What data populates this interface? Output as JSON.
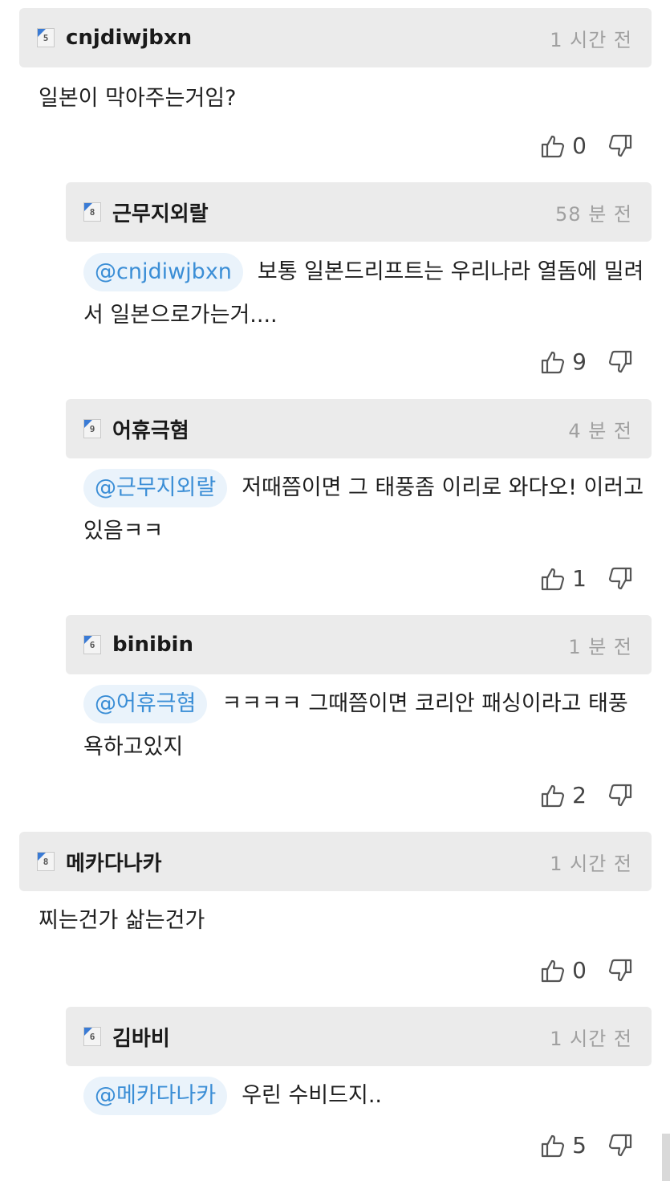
{
  "comments": [
    {
      "user": "cnjdiwjbxn",
      "level": "5",
      "time": "1 시간 전",
      "mention": "",
      "text": "일본이 막아주는거임?",
      "likes": "0"
    },
    {
      "user": "근무지외랄",
      "level": "8",
      "time": "58 분 전",
      "mention": "@cnjdiwjbxn",
      "text": "보통 일본드리프트는 우리나라 열돔에 밀려서 일본으로가는거....",
      "likes": "9"
    },
    {
      "user": "어휴극혐",
      "level": "9",
      "time": "4 분 전",
      "mention": "@근무지외랄",
      "text": "저때쯤이면 그 태풍좀 이리로 와다오! 이러고있음ㅋㅋ",
      "likes": "1"
    },
    {
      "user": "binibin",
      "level": "6",
      "time": "1 분 전",
      "mention": "@어휴극혐",
      "text": "ㅋㅋㅋㅋ 그때쯤이면 코리안 패싱이라고 태풍 욕하고있지",
      "likes": "2"
    },
    {
      "user": "메카다나카",
      "level": "8",
      "time": "1 시간 전",
      "mention": "",
      "text": "찌는건가 삶는건가",
      "likes": "0"
    },
    {
      "user": "김바비",
      "level": "6",
      "time": "1 시간 전",
      "mention": "@메카다나카",
      "text": "우린 수비드지..",
      "likes": "5"
    }
  ],
  "icons": {
    "like": "thumbs-up-icon",
    "dislike": "thumbs-down-icon",
    "level": "level-badge-icon"
  }
}
